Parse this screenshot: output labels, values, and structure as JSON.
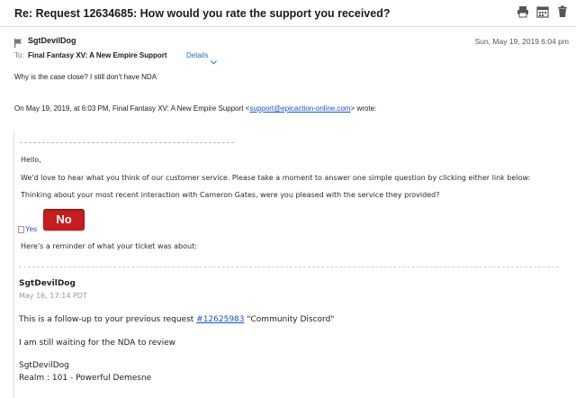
{
  "subject": "Re: Request 12634685: How would you rate the support you received?",
  "toolbar": {
    "icons": [
      "print-icon",
      "calendar-icon",
      "trash-icon"
    ]
  },
  "header": {
    "sender": "SgtDevilDog",
    "date": "Sun, May 19, 2019 6:04 pm",
    "to_label": "To:",
    "to_name": "Final Fantasy XV: A New Empire Support",
    "details_label": "Details"
  },
  "reply": {
    "text": "Why is the case close? I still don't have NDA",
    "quote_intro_prefix": "On May 19, 2019, at 6:03 PM, Final Fantasy XV: A New Empire Support <",
    "quote_intro_email": "support@epicaction-online.com",
    "quote_intro_suffix": "> wrote:"
  },
  "quoted": {
    "greeting": "Hello,",
    "line1": "We'd love to hear what you think of our customer service. Please take a moment to answer one simple question by clicking either link below:",
    "line2": "Thinking about your most recent interaction with Cameron Gates, were you pleased with the service they provided?",
    "yes_alt": "Yes",
    "no_label": "No",
    "reminder": "Here's a reminder of what your ticket was about:",
    "author": "SgtDevilDog",
    "author_date": "May 16, 17:14 PDT",
    "followup_prefix": "This is a follow-up to your previous request ",
    "followup_link": "#12625983",
    "followup_suffix": " \"Community Discord\"",
    "waiting": "I am still waiting for the NDA to review",
    "sig_name": "SgtDevilDog",
    "sig_realm": "Realm : 101 - Powerful Demesne"
  },
  "colors": {
    "no_button": "#c81d1d",
    "link": "#1a4fd6",
    "details": "#1f6fc4"
  }
}
